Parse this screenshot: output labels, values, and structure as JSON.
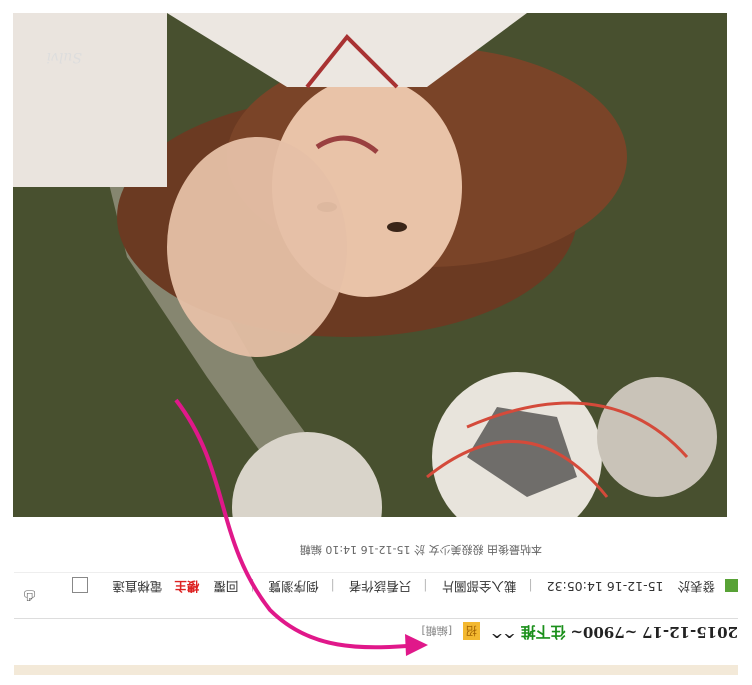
{
  "watermark": "Sulvi",
  "caption": "本帖最後由 殺殺美少女 於 15-12-16 14:10 編輯",
  "toolbar": {
    "posted_prefix": "發表於",
    "posted_time": "15-12-16 14:05:32",
    "download_all": "載入全部圖片",
    "only_author": "只看該作者",
    "reverse_order": "倒序瀏覽",
    "reply": "回覆",
    "owner": "樓主",
    "direct_floor": "電梯直達"
  },
  "post": {
    "date": "2015-12-17",
    "text_prefix": "~7900~",
    "text_green": "往下推",
    "suffix": "^^",
    "tag": "招",
    "edit": "[編輯]"
  },
  "colors": {
    "arrow": "#e0188a",
    "green": "#1a8f1a",
    "red": "#dd2222"
  }
}
